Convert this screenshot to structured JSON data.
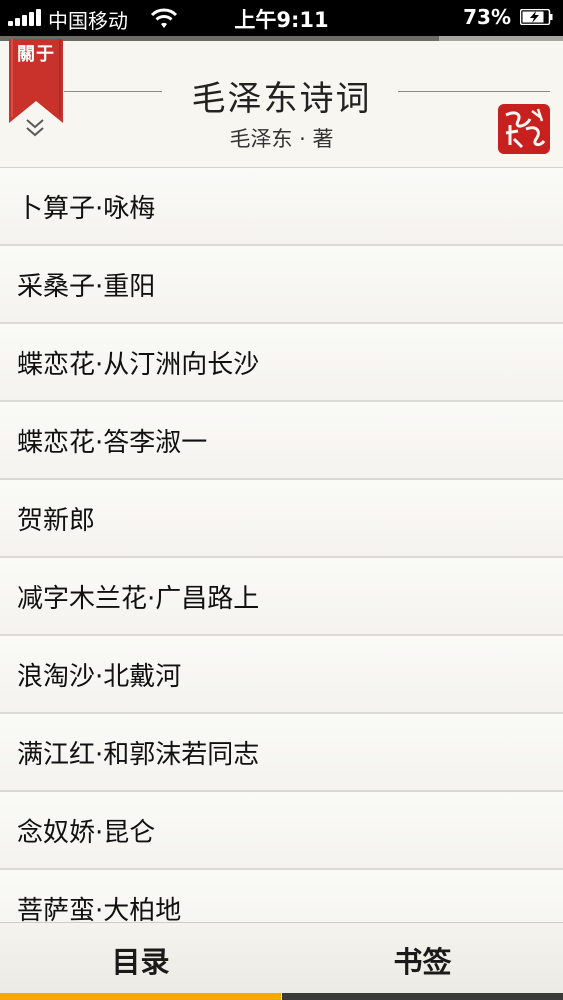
{
  "status_bar": {
    "carrier": "中国移动",
    "time": "上午9:11",
    "battery": "73%"
  },
  "progress": {
    "fraction": 0.78
  },
  "header": {
    "ribbon_label": "關于",
    "title": "毛泽东诗词",
    "author": "毛泽东 · 著"
  },
  "chapters": [
    "卜算子·咏梅",
    "采桑子·重阳",
    "蝶恋花·从汀洲向长沙",
    "蝶恋花·答李淑一",
    "贺新郎",
    "减字木兰花·广昌路上",
    "浪淘沙·北戴河",
    "满江红·和郭沫若同志",
    "念奴娇·昆仑",
    "菩萨蛮·大柏地"
  ],
  "tabs": {
    "toc": "目录",
    "bookmarks": "书签"
  },
  "colors": {
    "ribbon": "#c8322a",
    "seal": "#c8201e",
    "active_tab": "#f5a800",
    "inactive_tab": "#3a3a3a"
  }
}
